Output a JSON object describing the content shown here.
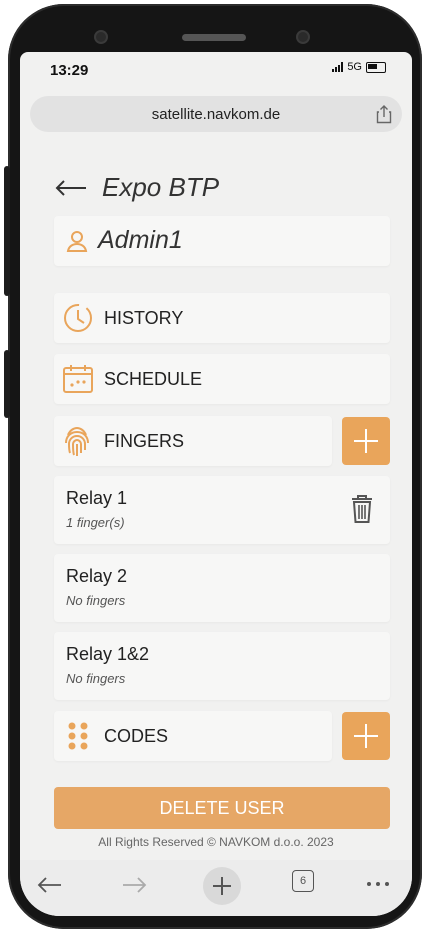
{
  "status": {
    "time": "13:29",
    "network": "5G"
  },
  "browser": {
    "url": "satellite.navkom.de",
    "tab_count": "6"
  },
  "header": {
    "title": "Expo BTP",
    "user": "Admin1"
  },
  "menu": {
    "history_label": "HISTORY",
    "schedule_label": "SCHEDULE",
    "fingers_label": "FINGERS",
    "codes_label": "CODES"
  },
  "relays": [
    {
      "name": "Relay 1",
      "detail": "1 finger(s)"
    },
    {
      "name": "Relay 2",
      "detail": "No fingers"
    },
    {
      "name": "Relay 1&2",
      "detail": "No fingers"
    }
  ],
  "actions": {
    "delete_label": "DELETE USER"
  },
  "footer": {
    "text": "All Rights Reserved © NAVKOM d.o.o. 2023"
  },
  "colors": {
    "accent": "#e9a55b",
    "background": "#f1f1f0"
  }
}
